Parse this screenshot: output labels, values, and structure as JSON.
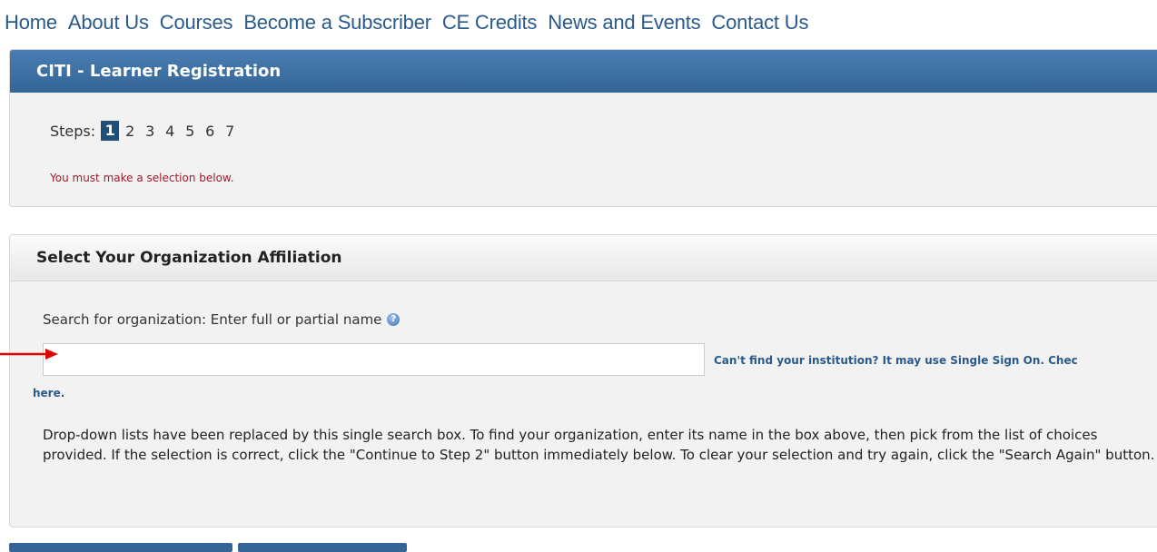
{
  "nav": {
    "items": [
      "Home",
      "About Us",
      "Courses",
      "Become a Subscriber",
      "CE Credits",
      "News and Events",
      "Contact Us"
    ]
  },
  "registration": {
    "title": "CITI - Learner Registration",
    "steps_label": "Steps:",
    "steps": [
      "1",
      "2",
      "3",
      "4",
      "5",
      "6",
      "7"
    ],
    "active_step": "1",
    "error": "You must make a selection below."
  },
  "affiliation": {
    "title": "Select Your Organization Affiliation",
    "search_label": "Search for organization: Enter full or partial name",
    "search_value": "",
    "sso_link_line1": "Can't find your institution? It may use Single Sign On. Chec",
    "sso_link_line2": "here.",
    "description": "Drop-down lists have been replaced by this single search box. To find your organization, enter its name in the box above, then pick from the list of choices provided. If the selection is correct, click the \"Continue to Step 2\" button immediately below. To clear your selection and try again, click the \"Search Again\" button."
  },
  "colors": {
    "header_blue": "#346596",
    "link_blue": "#2a5a8c",
    "error_red": "#9c1c2c",
    "arrow_red": "#e00000"
  },
  "icons": {
    "help": "help-icon",
    "arrow": "arrow-right-icon"
  }
}
